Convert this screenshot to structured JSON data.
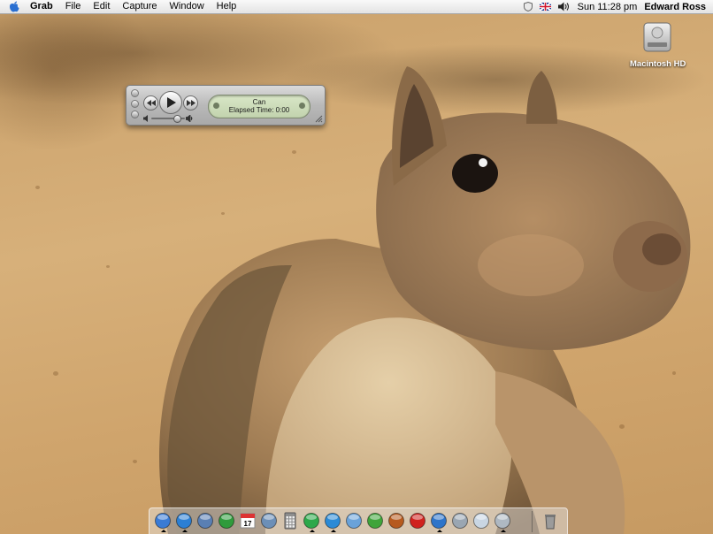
{
  "menubar": {
    "apple_icon": "apple-icon",
    "items": [
      "Grab",
      "File",
      "Edit",
      "Capture",
      "Window",
      "Help"
    ],
    "status_icons": [
      "shield-icon",
      "flag-icon",
      "volume-icon"
    ],
    "clock": "Sun 11:28 pm",
    "user": "Edward Ross"
  },
  "desktop": {
    "hd_label": "Macintosh HD",
    "hd_icon": "hard-drive-icon"
  },
  "player": {
    "track": "Can",
    "elapsed": "Elapsed Time: 0:00",
    "volume_level": 0.8,
    "state": "paused"
  },
  "dock": {
    "items": [
      {
        "icon": "finder-icon",
        "running": true,
        "color": "#3a7bd5"
      },
      {
        "icon": "safari-icon",
        "running": true,
        "color": "#2b7fd4"
      },
      {
        "icon": "mail-icon",
        "running": false,
        "color": "#5a7fb3"
      },
      {
        "icon": "ichat-icon",
        "running": false,
        "color": "#2f9b3c"
      },
      {
        "icon": "ical-icon",
        "running": false,
        "color": "#ffffff",
        "day": "17"
      },
      {
        "icon": "iphoto-icon",
        "running": false,
        "color": "#6c8fb7"
      },
      {
        "icon": "calculator-icon",
        "running": false,
        "color": "#8e8e8e"
      },
      {
        "icon": "itunes-icon",
        "running": true,
        "color": "#2da84a"
      },
      {
        "icon": "network-icon",
        "running": true,
        "color": "#2b8ad6"
      },
      {
        "icon": "books-icon",
        "running": false,
        "color": "#6aa2d9"
      },
      {
        "icon": "sherlock-icon",
        "running": false,
        "color": "#3fa43a"
      },
      {
        "icon": "garageband-icon",
        "running": false,
        "color": "#b65a1e"
      },
      {
        "icon": "opera-icon",
        "running": false,
        "color": "#d0221e"
      },
      {
        "icon": "quicktime-icon",
        "running": true,
        "color": "#2e74c9"
      },
      {
        "icon": "utility-icon",
        "running": false,
        "color": "#9aa6b2"
      },
      {
        "icon": "preview-icon",
        "running": false,
        "color": "#c9d6e3"
      },
      {
        "icon": "grab-icon",
        "running": true,
        "color": "#aeb8c2"
      },
      {
        "icon": "trash-icon",
        "running": false,
        "color": "#9b9b9b"
      }
    ]
  }
}
